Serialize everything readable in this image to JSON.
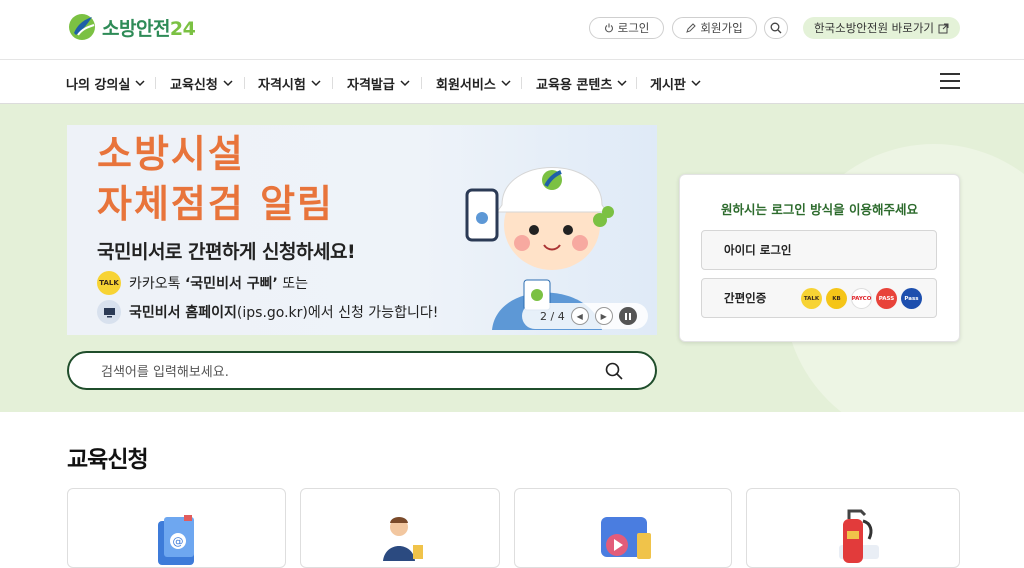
{
  "brand": {
    "name": "소방안전",
    "num": "24"
  },
  "top": {
    "login": "로그인",
    "signup": "회원가입",
    "kfi_link": "한국소방안전원 바로가기"
  },
  "nav": [
    "나의 강의실",
    "교육신청",
    "자격시험",
    "자격발급",
    "회원서비스",
    "교육용 콘텐츠",
    "게시판"
  ],
  "banner": {
    "title_line1": "소방시설",
    "title_line2": "자체점검 알림",
    "subtitle": "국민비서로 간편하게 신청하세요!",
    "row1_prefix": "카카오톡 ",
    "row1_bold": "‘국민비서 구삐’",
    "row1_suffix": " 또는",
    "row2_bold": "국민비서 홈페이지",
    "row2_suffix": "(ips.go.kr)에서 신청 가능합니다!",
    "kakao_icon_text": "TALK",
    "page_current": "2",
    "page_total": "4"
  },
  "login_box": {
    "title": "원하시는 로그인 방식을 이용해주세요",
    "id_login": "아이디 로그인",
    "easy_auth": "간편인증",
    "sns": [
      {
        "label": "TALK",
        "color": "#f7d334",
        "text_color": "#3b2a1a"
      },
      {
        "label": "KB",
        "color": "#f5c518",
        "text_color": "#3b2a1a"
      },
      {
        "label": "PAYCO",
        "color": "#ffffff",
        "text_color": "#e0232a"
      },
      {
        "label": "PASS",
        "color": "#e8433a",
        "text_color": "#ffffff"
      },
      {
        "label": "Pass",
        "color": "#1d4fae",
        "text_color": "#ffffff"
      }
    ]
  },
  "search": {
    "placeholder": "검색어를 입력해보세요."
  },
  "section": {
    "title": "교육신청"
  },
  "colors": {
    "accent_green": "#2e8b57",
    "hero_bg": "#e4f0d8",
    "banner_orange": "#e8743b"
  }
}
